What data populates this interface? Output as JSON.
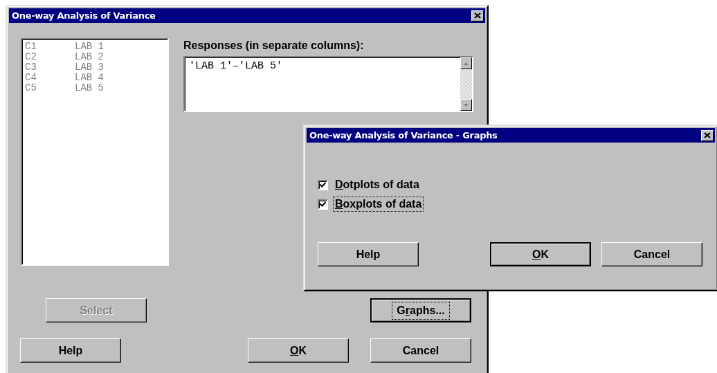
{
  "main_window": {
    "title": "One-way Analysis of Variance",
    "variables": [
      {
        "column": "C1",
        "name": "LAB 1"
      },
      {
        "column": "C2",
        "name": "LAB 2"
      },
      {
        "column": "C3",
        "name": "LAB 3"
      },
      {
        "column": "C4",
        "name": "LAB 4"
      },
      {
        "column": "C5",
        "name": "LAB 5"
      }
    ],
    "variables_disabled": true,
    "responses": {
      "label": "Responses (in separate columns):",
      "value": "'LAB 1'–'LAB 5'"
    },
    "buttons": [
      {
        "kind": "select",
        "before": "Select",
        "disabled": true,
        "focused": false,
        "default": false
      },
      {
        "kind": "graphs",
        "before": "G",
        "accel": "r",
        "after": "aphs...",
        "disabled": false,
        "focused": true,
        "default": false
      },
      {
        "kind": "help",
        "before": "Help",
        "disabled": false,
        "focused": false,
        "default": false
      },
      {
        "kind": "ok",
        "accel": "O",
        "after": "K",
        "disabled": false,
        "focused": false,
        "default": false
      },
      {
        "kind": "cancel",
        "before": "Cancel",
        "disabled": false,
        "focused": false,
        "default": false
      }
    ]
  },
  "graphs_window": {
    "title": "One-way Analysis of Variance - Graphs",
    "options": [
      {
        "accel": "D",
        "after": "otplots of data",
        "checked": true,
        "focused": false
      },
      {
        "accel": "B",
        "after": "oxplots of data",
        "checked": true,
        "focused": true
      }
    ],
    "buttons": [
      {
        "kind": "help",
        "before": "Help",
        "disabled": false,
        "focused": false,
        "default": false
      },
      {
        "kind": "ok",
        "accel": "O",
        "after": "K",
        "disabled": false,
        "focused": false,
        "default": true
      },
      {
        "kind": "cancel",
        "before": "Cancel",
        "disabled": false,
        "focused": false,
        "default": false
      }
    ]
  }
}
